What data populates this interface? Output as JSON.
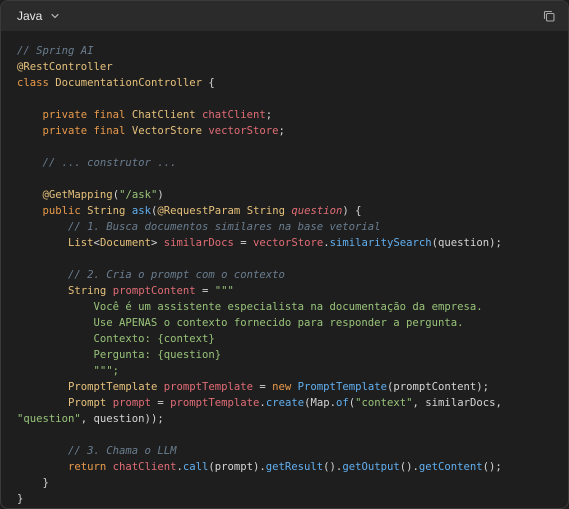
{
  "header": {
    "language": "Java",
    "chevron_icon": "chevron-down-icon",
    "copy_icon": "copy-icon"
  },
  "code_lines": [
    [
      {
        "t": "// Spring AI",
        "c": "cm"
      }
    ],
    [
      {
        "t": "@RestController",
        "c": "an"
      }
    ],
    [
      {
        "t": "class ",
        "c": "kw"
      },
      {
        "t": "DocumentationController",
        "c": "ty"
      },
      {
        "t": " {",
        "c": "pl"
      }
    ],
    [],
    [
      {
        "t": "    private final ",
        "c": "kw"
      },
      {
        "t": "ChatClient",
        "c": "ty"
      },
      {
        "t": " ",
        "c": "pl"
      },
      {
        "t": "chatClient",
        "c": "fd"
      },
      {
        "t": ";",
        "c": "pl"
      }
    ],
    [
      {
        "t": "    private final ",
        "c": "kw"
      },
      {
        "t": "VectorStore",
        "c": "ty"
      },
      {
        "t": " ",
        "c": "pl"
      },
      {
        "t": "vectorStore",
        "c": "fd"
      },
      {
        "t": ";",
        "c": "pl"
      }
    ],
    [],
    [
      {
        "t": "    // ... construtor ...",
        "c": "cm"
      }
    ],
    [],
    [
      {
        "t": "    ",
        "c": "pl"
      },
      {
        "t": "@GetMapping",
        "c": "an"
      },
      {
        "t": "(",
        "c": "pl"
      },
      {
        "t": "\"/ask\"",
        "c": "st"
      },
      {
        "t": ")",
        "c": "pl"
      }
    ],
    [
      {
        "t": "    public ",
        "c": "kw"
      },
      {
        "t": "String",
        "c": "ty"
      },
      {
        "t": " ",
        "c": "pl"
      },
      {
        "t": "ask",
        "c": "fn"
      },
      {
        "t": "(",
        "c": "pl"
      },
      {
        "t": "@RequestParam",
        "c": "an"
      },
      {
        "t": " ",
        "c": "pl"
      },
      {
        "t": "String",
        "c": "ty"
      },
      {
        "t": " ",
        "c": "pl"
      },
      {
        "t": "question",
        "c": "pi"
      },
      {
        "t": ") {",
        "c": "pl"
      }
    ],
    [
      {
        "t": "        // 1. Busca documentos similares na base vetorial",
        "c": "cm"
      }
    ],
    [
      {
        "t": "        ",
        "c": "pl"
      },
      {
        "t": "List",
        "c": "ty"
      },
      {
        "t": "<",
        "c": "pl"
      },
      {
        "t": "Document",
        "c": "ty"
      },
      {
        "t": "> ",
        "c": "pl"
      },
      {
        "t": "similarDocs",
        "c": "fd"
      },
      {
        "t": " = ",
        "c": "pl"
      },
      {
        "t": "vectorStore",
        "c": "fd"
      },
      {
        "t": ".",
        "c": "pl"
      },
      {
        "t": "similaritySearch",
        "c": "fn"
      },
      {
        "t": "(question);",
        "c": "pl"
      }
    ],
    [],
    [
      {
        "t": "        // 2. Cria o prompt com o contexto",
        "c": "cm"
      }
    ],
    [
      {
        "t": "        ",
        "c": "pl"
      },
      {
        "t": "String",
        "c": "ty"
      },
      {
        "t": " ",
        "c": "pl"
      },
      {
        "t": "promptContent",
        "c": "fd"
      },
      {
        "t": " = ",
        "c": "pl"
      },
      {
        "t": "\"\"\"",
        "c": "st"
      }
    ],
    [
      {
        "t": "            Você é um assistente especialista na documentação da empresa.",
        "c": "st"
      }
    ],
    [
      {
        "t": "            Use APENAS o contexto fornecido para responder a pergunta.",
        "c": "st"
      }
    ],
    [
      {
        "t": "            Contexto: {context}",
        "c": "st"
      }
    ],
    [
      {
        "t": "            Pergunta: {question}",
        "c": "st"
      }
    ],
    [
      {
        "t": "            \"\"\";",
        "c": "st"
      }
    ],
    [
      {
        "t": "        ",
        "c": "pl"
      },
      {
        "t": "PromptTemplate",
        "c": "ty"
      },
      {
        "t": " ",
        "c": "pl"
      },
      {
        "t": "promptTemplate",
        "c": "fd"
      },
      {
        "t": " = ",
        "c": "pl"
      },
      {
        "t": "new ",
        "c": "kw"
      },
      {
        "t": "PromptTemplate",
        "c": "fn"
      },
      {
        "t": "(promptContent);",
        "c": "pl"
      }
    ],
    [
      {
        "t": "        ",
        "c": "pl"
      },
      {
        "t": "Prompt",
        "c": "ty"
      },
      {
        "t": " ",
        "c": "pl"
      },
      {
        "t": "prompt",
        "c": "fd"
      },
      {
        "t": " = ",
        "c": "pl"
      },
      {
        "t": "promptTemplate",
        "c": "fd"
      },
      {
        "t": ".",
        "c": "pl"
      },
      {
        "t": "create",
        "c": "fn"
      },
      {
        "t": "(Map.",
        "c": "pl"
      },
      {
        "t": "of",
        "c": "fn"
      },
      {
        "t": "(",
        "c": "pl"
      },
      {
        "t": "\"context\"",
        "c": "st"
      },
      {
        "t": ", similarDocs,",
        "c": "pl"
      }
    ],
    [
      {
        "t": "\"question\"",
        "c": "st"
      },
      {
        "t": ", question));",
        "c": "pl"
      }
    ],
    [],
    [
      {
        "t": "        // 3. Chama o LLM",
        "c": "cm"
      }
    ],
    [
      {
        "t": "        return ",
        "c": "kw"
      },
      {
        "t": "chatClient",
        "c": "fd"
      },
      {
        "t": ".",
        "c": "pl"
      },
      {
        "t": "call",
        "c": "fn"
      },
      {
        "t": "(prompt).",
        "c": "pl"
      },
      {
        "t": "getResult",
        "c": "fn"
      },
      {
        "t": "().",
        "c": "pl"
      },
      {
        "t": "getOutput",
        "c": "fn"
      },
      {
        "t": "().",
        "c": "pl"
      },
      {
        "t": "getContent",
        "c": "fn"
      },
      {
        "t": "();",
        "c": "pl"
      }
    ],
    [
      {
        "t": "    }",
        "c": "pl"
      }
    ],
    [
      {
        "t": "}",
        "c": "pl"
      }
    ]
  ]
}
